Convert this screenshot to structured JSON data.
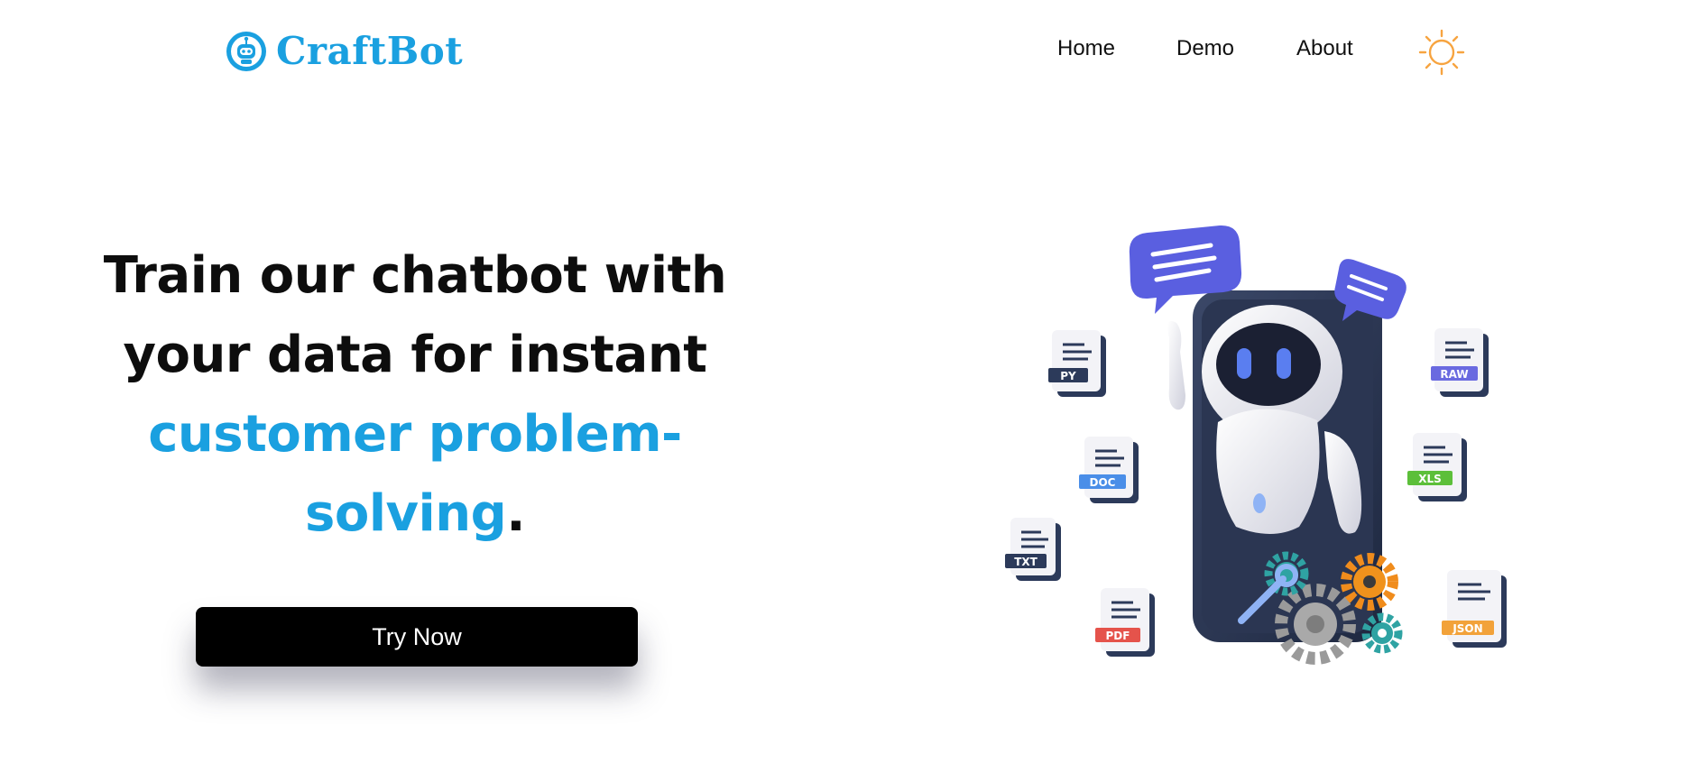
{
  "brand": {
    "name": "CraftBot",
    "logo_icon": "robot-head-icon",
    "color": "#1aa0e0"
  },
  "nav": {
    "items": [
      {
        "label": "Home"
      },
      {
        "label": "Demo"
      },
      {
        "label": "About"
      }
    ],
    "theme_icon": "sun-icon",
    "theme_color": "#f7a440"
  },
  "hero": {
    "title_line1": "Train our chatbot with",
    "title_line2": "your data for instant",
    "title_accent1": "customer problem-",
    "title_accent2": "solving",
    "title_period": ".",
    "cta_label": "Try Now",
    "accent_color": "#1aa0e0"
  },
  "illustration": {
    "file_tags": [
      "PY",
      "DOC",
      "TXT",
      "PDF",
      "RAW",
      "XLS",
      "JSON"
    ],
    "tag_colors": {
      "PY": "#2c3a5a",
      "DOC": "#4a8ee8",
      "TXT": "#2c3a5a",
      "PDF": "#e5534b",
      "RAW": "#6a6ae0",
      "XLS": "#5cbf3a",
      "JSON": "#f2a23a"
    }
  }
}
